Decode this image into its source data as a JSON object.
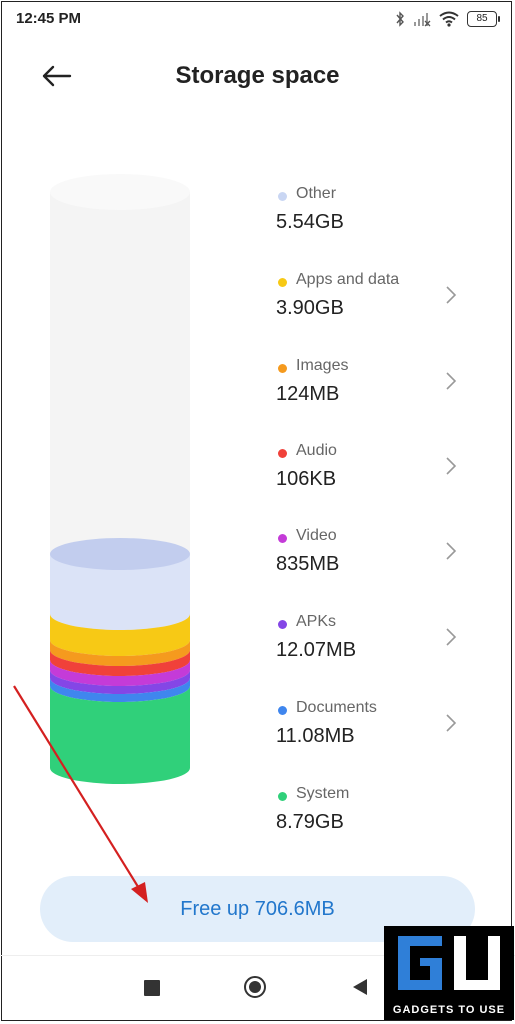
{
  "status_bar": {
    "time": "12:45 PM",
    "battery": "85",
    "icons": [
      "bluetooth-icon",
      "signal-off-icon",
      "wifi-icon",
      "battery-icon"
    ]
  },
  "header": {
    "title": "Storage space",
    "back_icon": "back-arrow-icon"
  },
  "storage": {
    "items": [
      {
        "label": "Other",
        "value": "5.54GB",
        "color": "#c9d6f3",
        "has_chevron": false
      },
      {
        "label": "Apps and data",
        "value": "3.90GB",
        "color": "#f7c915",
        "has_chevron": true
      },
      {
        "label": "Images",
        "value": "124MB",
        "color": "#f59a1e",
        "has_chevron": true
      },
      {
        "label": "Audio",
        "value": "106KB",
        "color": "#f0413a",
        "has_chevron": true
      },
      {
        "label": "Video",
        "value": "835MB",
        "color": "#c43bd8",
        "has_chevron": true
      },
      {
        "label": "APKs",
        "value": "12.07MB",
        "color": "#8446e6",
        "has_chevron": true
      },
      {
        "label": "Documents",
        "value": "11.08MB",
        "color": "#3f86ee",
        "has_chevron": true
      },
      {
        "label": "System",
        "value": "8.79GB",
        "color": "#30d07a",
        "has_chevron": false
      }
    ]
  },
  "actions": {
    "free_up_label": "Free up 706.6MB"
  },
  "nav_bar": {
    "icons": [
      "recents-icon",
      "home-icon",
      "back-icon"
    ]
  },
  "watermark": {
    "logo_text": "GU",
    "caption": "GADGETS TO USE"
  },
  "colors": {
    "accent": "#2277cc",
    "button_bg": "#e2eefa",
    "annotation_arrow": "#d42020"
  }
}
